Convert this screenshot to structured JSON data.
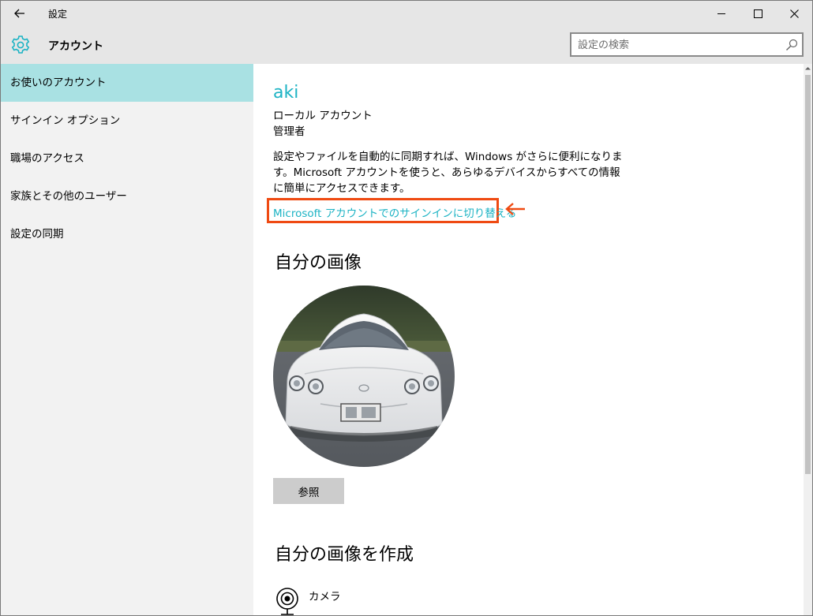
{
  "window": {
    "title": "設定"
  },
  "header": {
    "title": "アカウント",
    "search_placeholder": "設定の検索"
  },
  "sidebar": {
    "items": [
      {
        "label": "お使いのアカウント",
        "active": true
      },
      {
        "label": "サインイン オプション",
        "active": false
      },
      {
        "label": "職場のアクセス",
        "active": false
      },
      {
        "label": "家族とその他のユーザー",
        "active": false
      },
      {
        "label": "設定の同期",
        "active": false
      }
    ]
  },
  "account": {
    "user_name": "aki",
    "account_type": "ローカル アカウント",
    "role": "管理者",
    "description": "設定やファイルを自動的に同期すれば、Windows がさらに便利になります。Microsoft アカウントを使うと、あらゆるデバイスからすべての情報に簡単にアクセスできます。",
    "switch_link": "Microsoft アカウントでのサインインに切り替える"
  },
  "picture": {
    "heading": "自分の画像",
    "browse_label": "参照"
  },
  "create": {
    "heading": "自分の画像を作成",
    "camera_label": "カメラ"
  },
  "colors": {
    "accent": "#1cb3c4",
    "active_nav": "#a9e1e3",
    "annotation": "#ef4a12"
  }
}
